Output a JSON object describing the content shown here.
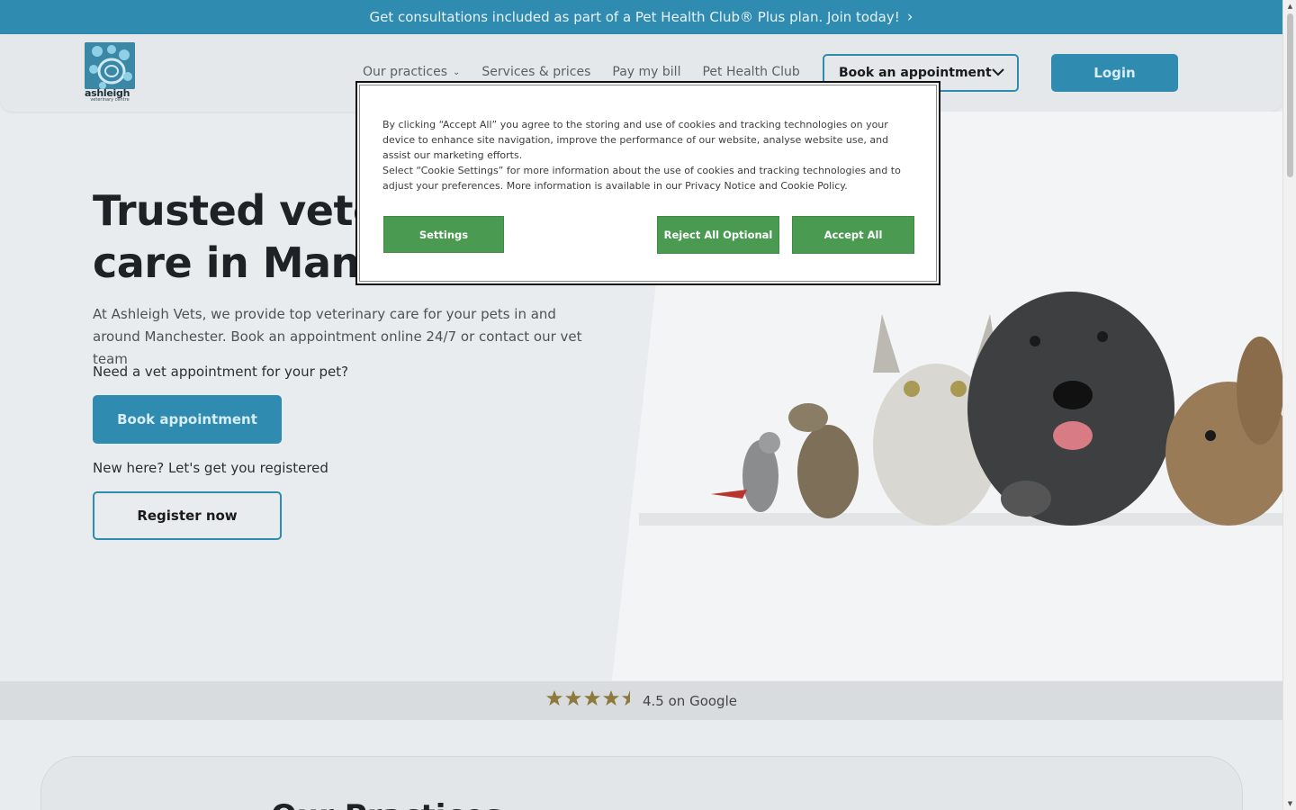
{
  "promo": {
    "text": "Get consultations included as part of a Pet Health Club® Plus plan. Join today!",
    "chevron": "›"
  },
  "header": {
    "logo_word": "ashleigh",
    "logo_sub": "veterinary centre",
    "nav": [
      {
        "label": "Our practices",
        "has_dropdown": true
      },
      {
        "label": "Services & prices"
      },
      {
        "label": "Pay my bill"
      },
      {
        "label": "Pet Health Club"
      }
    ],
    "book_label": "Book an appointment",
    "login_label": "Login"
  },
  "hero": {
    "title_line1": "Trusted vete",
    "title_line2": "care in Manc",
    "description": "At Ashleigh Vets, we provide top veterinary care for your pets in and around Manchester. Book an appointment online 24/7 or contact our vet team",
    "need_text": "Need a vet appointment for your pet?",
    "book_button": "Book appointment",
    "new_here": "New here? Let's get you registered",
    "register_button": "Register now"
  },
  "rating": {
    "stars": 4.5,
    "text": "4.5 on Google"
  },
  "practices": {
    "heading": "Our Practices"
  },
  "cookie": {
    "paragraph1": "By clicking “Accept All” you agree to the storing and use of cookies and tracking technologies on your device to enhance site navigation, improve the performance of our website, analyse website use, and assist our marketing efforts.",
    "paragraph2": "Select “Cookie Settings” for more information about the use of cookies and tracking technologies and to adjust your preferences. More information is available in our Privacy Notice and Cookie Policy.",
    "settings_label": "Settings",
    "reject_label": "Reject All Optional",
    "accept_label": "Accept All"
  },
  "colors": {
    "brand": "#2f8bb0",
    "cookie_button": "#4a9a51"
  }
}
